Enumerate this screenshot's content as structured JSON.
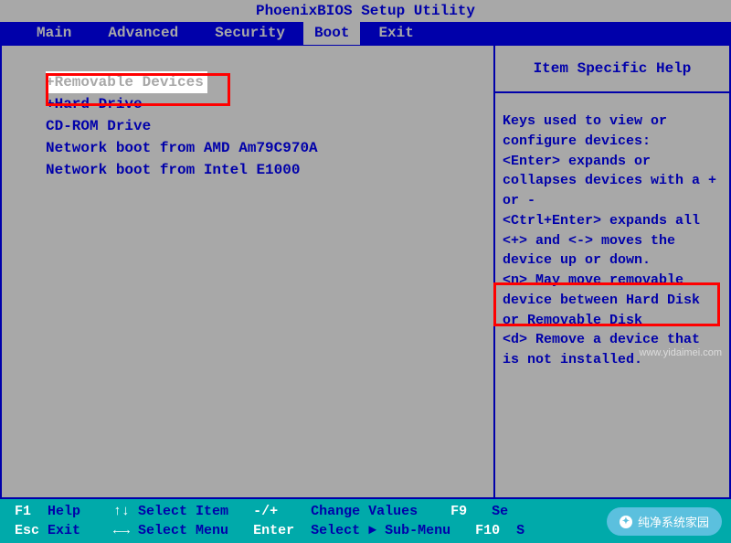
{
  "title": "PhoenixBIOS Setup Utility",
  "menu": {
    "items": [
      "Main",
      "Advanced",
      "Security",
      "Boot",
      "Exit"
    ],
    "active_index": 3
  },
  "boot_panel": {
    "items": [
      {
        "label": "+Removable Devices",
        "selected": true
      },
      {
        "label": "+Hard Drive",
        "selected": false
      },
      {
        "label": " CD-ROM Drive",
        "selected": false
      },
      {
        "label": " Network boot from AMD Am79C970A",
        "selected": false
      },
      {
        "label": " Network boot from Intel E1000",
        "selected": false
      }
    ]
  },
  "help_panel": {
    "title": "Item Specific Help",
    "body": "Keys used to view or configure devices:\n<Enter> expands or collapses devices with a + or -\n<Ctrl+Enter> expands all\n<+> and <-> moves the device up or down.\n<n> May move removable device between Hard Disk or Removable Disk\n<d> Remove a device that is not installed."
  },
  "footer": {
    "rows": [
      [
        {
          "key": "F1",
          "label": "Help"
        },
        {
          "key": "↑↓",
          "label": "Select Item"
        },
        {
          "key": "-/+",
          "label": "Change Values"
        },
        {
          "key": "F9",
          "label": "Se"
        }
      ],
      [
        {
          "key": "Esc",
          "label": "Exit"
        },
        {
          "key": "←→",
          "label": "Select Menu"
        },
        {
          "key": "Enter",
          "label": "Select ► Sub-Menu"
        },
        {
          "key": "F10",
          "label": "S"
        }
      ]
    ]
  },
  "watermark": "www.yidaimei.com",
  "badge": "纯净系统家园"
}
